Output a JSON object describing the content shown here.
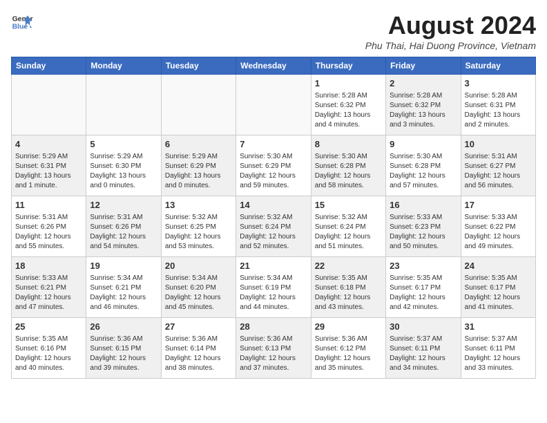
{
  "header": {
    "logo_line1": "General",
    "logo_line2": "Blue",
    "month_year": "August 2024",
    "location": "Phu Thai, Hai Duong Province, Vietnam"
  },
  "days_of_week": [
    "Sunday",
    "Monday",
    "Tuesday",
    "Wednesday",
    "Thursday",
    "Friday",
    "Saturday"
  ],
  "weeks": [
    [
      {
        "day": "",
        "info": "",
        "shade": "empty"
      },
      {
        "day": "",
        "info": "",
        "shade": "empty"
      },
      {
        "day": "",
        "info": "",
        "shade": "empty"
      },
      {
        "day": "",
        "info": "",
        "shade": "empty"
      },
      {
        "day": "1",
        "info": "Sunrise: 5:28 AM\nSunset: 6:32 PM\nDaylight: 13 hours\nand 4 minutes.",
        "shade": "white"
      },
      {
        "day": "2",
        "info": "Sunrise: 5:28 AM\nSunset: 6:32 PM\nDaylight: 13 hours\nand 3 minutes.",
        "shade": "shaded"
      },
      {
        "day": "3",
        "info": "Sunrise: 5:28 AM\nSunset: 6:31 PM\nDaylight: 13 hours\nand 2 minutes.",
        "shade": "white"
      }
    ],
    [
      {
        "day": "4",
        "info": "Sunrise: 5:29 AM\nSunset: 6:31 PM\nDaylight: 13 hours\nand 1 minute.",
        "shade": "shaded"
      },
      {
        "day": "5",
        "info": "Sunrise: 5:29 AM\nSunset: 6:30 PM\nDaylight: 13 hours\nand 0 minutes.",
        "shade": "white"
      },
      {
        "day": "6",
        "info": "Sunrise: 5:29 AM\nSunset: 6:29 PM\nDaylight: 13 hours\nand 0 minutes.",
        "shade": "shaded"
      },
      {
        "day": "7",
        "info": "Sunrise: 5:30 AM\nSunset: 6:29 PM\nDaylight: 12 hours\nand 59 minutes.",
        "shade": "white"
      },
      {
        "day": "8",
        "info": "Sunrise: 5:30 AM\nSunset: 6:28 PM\nDaylight: 12 hours\nand 58 minutes.",
        "shade": "shaded"
      },
      {
        "day": "9",
        "info": "Sunrise: 5:30 AM\nSunset: 6:28 PM\nDaylight: 12 hours\nand 57 minutes.",
        "shade": "white"
      },
      {
        "day": "10",
        "info": "Sunrise: 5:31 AM\nSunset: 6:27 PM\nDaylight: 12 hours\nand 56 minutes.",
        "shade": "shaded"
      }
    ],
    [
      {
        "day": "11",
        "info": "Sunrise: 5:31 AM\nSunset: 6:26 PM\nDaylight: 12 hours\nand 55 minutes.",
        "shade": "white"
      },
      {
        "day": "12",
        "info": "Sunrise: 5:31 AM\nSunset: 6:26 PM\nDaylight: 12 hours\nand 54 minutes.",
        "shade": "shaded"
      },
      {
        "day": "13",
        "info": "Sunrise: 5:32 AM\nSunset: 6:25 PM\nDaylight: 12 hours\nand 53 minutes.",
        "shade": "white"
      },
      {
        "day": "14",
        "info": "Sunrise: 5:32 AM\nSunset: 6:24 PM\nDaylight: 12 hours\nand 52 minutes.",
        "shade": "shaded"
      },
      {
        "day": "15",
        "info": "Sunrise: 5:32 AM\nSunset: 6:24 PM\nDaylight: 12 hours\nand 51 minutes.",
        "shade": "white"
      },
      {
        "day": "16",
        "info": "Sunrise: 5:33 AM\nSunset: 6:23 PM\nDaylight: 12 hours\nand 50 minutes.",
        "shade": "shaded"
      },
      {
        "day": "17",
        "info": "Sunrise: 5:33 AM\nSunset: 6:22 PM\nDaylight: 12 hours\nand 49 minutes.",
        "shade": "white"
      }
    ],
    [
      {
        "day": "18",
        "info": "Sunrise: 5:33 AM\nSunset: 6:21 PM\nDaylight: 12 hours\nand 47 minutes.",
        "shade": "shaded"
      },
      {
        "day": "19",
        "info": "Sunrise: 5:34 AM\nSunset: 6:21 PM\nDaylight: 12 hours\nand 46 minutes.",
        "shade": "white"
      },
      {
        "day": "20",
        "info": "Sunrise: 5:34 AM\nSunset: 6:20 PM\nDaylight: 12 hours\nand 45 minutes.",
        "shade": "shaded"
      },
      {
        "day": "21",
        "info": "Sunrise: 5:34 AM\nSunset: 6:19 PM\nDaylight: 12 hours\nand 44 minutes.",
        "shade": "white"
      },
      {
        "day": "22",
        "info": "Sunrise: 5:35 AM\nSunset: 6:18 PM\nDaylight: 12 hours\nand 43 minutes.",
        "shade": "shaded"
      },
      {
        "day": "23",
        "info": "Sunrise: 5:35 AM\nSunset: 6:17 PM\nDaylight: 12 hours\nand 42 minutes.",
        "shade": "white"
      },
      {
        "day": "24",
        "info": "Sunrise: 5:35 AM\nSunset: 6:17 PM\nDaylight: 12 hours\nand 41 minutes.",
        "shade": "shaded"
      }
    ],
    [
      {
        "day": "25",
        "info": "Sunrise: 5:35 AM\nSunset: 6:16 PM\nDaylight: 12 hours\nand 40 minutes.",
        "shade": "white"
      },
      {
        "day": "26",
        "info": "Sunrise: 5:36 AM\nSunset: 6:15 PM\nDaylight: 12 hours\nand 39 minutes.",
        "shade": "shaded"
      },
      {
        "day": "27",
        "info": "Sunrise: 5:36 AM\nSunset: 6:14 PM\nDaylight: 12 hours\nand 38 minutes.",
        "shade": "white"
      },
      {
        "day": "28",
        "info": "Sunrise: 5:36 AM\nSunset: 6:13 PM\nDaylight: 12 hours\nand 37 minutes.",
        "shade": "shaded"
      },
      {
        "day": "29",
        "info": "Sunrise: 5:36 AM\nSunset: 6:12 PM\nDaylight: 12 hours\nand 35 minutes.",
        "shade": "white"
      },
      {
        "day": "30",
        "info": "Sunrise: 5:37 AM\nSunset: 6:11 PM\nDaylight: 12 hours\nand 34 minutes.",
        "shade": "shaded"
      },
      {
        "day": "31",
        "info": "Sunrise: 5:37 AM\nSunset: 6:11 PM\nDaylight: 12 hours\nand 33 minutes.",
        "shade": "white"
      }
    ]
  ]
}
